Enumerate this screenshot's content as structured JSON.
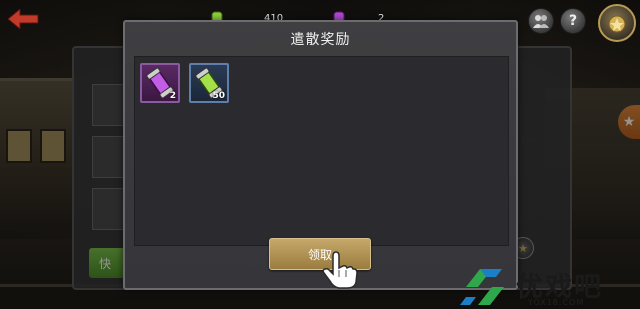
{
  "resources": [
    {
      "name": "green-gem",
      "value": "410"
    },
    {
      "name": "purple-gem",
      "value": "2"
    }
  ],
  "top_buttons": {
    "help_label": "?"
  },
  "dialog": {
    "title": "遣散奖励",
    "items": [
      {
        "icon": "purple-capsule-icon",
        "count": "2"
      },
      {
        "icon": "green-capsule-icon",
        "count": "50"
      }
    ],
    "claim_label": "领取"
  },
  "background": {
    "green_button_label": "快"
  },
  "watermark": {
    "title": "优戏吧",
    "subtitle": "YOX18.COM"
  },
  "colors": {
    "claim_button": "#b99a5a",
    "under_green_button": "#6aad3c",
    "purple_item_border": "#8a5aa0",
    "green_item_border": "#5f7fa8",
    "watermark_green": "#2ea84a"
  }
}
